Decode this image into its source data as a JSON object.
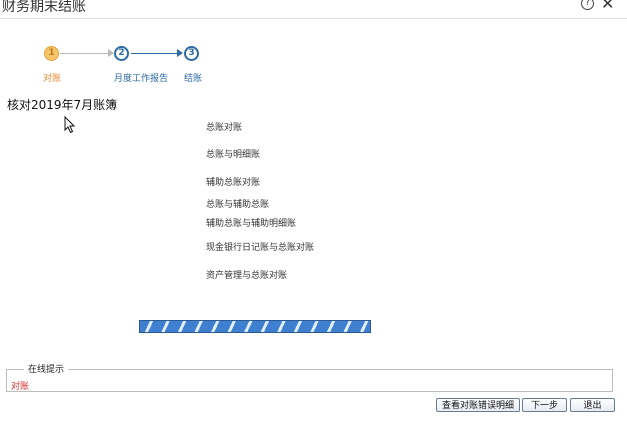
{
  "window": {
    "title": "财务期末结账",
    "help_icon_glyph": "?",
    "close_icon_glyph": "✕"
  },
  "steps": [
    {
      "number": "1",
      "label": "对账",
      "state": "current"
    },
    {
      "number": "2",
      "label": "月度工作报告",
      "state": "pending"
    },
    {
      "number": "3",
      "label": "结账",
      "state": "pending"
    }
  ],
  "main": {
    "heading": "核对2019年7月账簿",
    "check_items": [
      "总账对账",
      "总账与明细账",
      "辅助总账对账",
      "总账与辅助总账",
      "辅助总账与辅助明细账",
      "现金银行日记账与总账对账",
      "资产管理与总账对账"
    ],
    "progress_state": "running"
  },
  "online_tip": {
    "legend": "在线提示",
    "message": "对账"
  },
  "buttons": {
    "view_errors": "查看对账错误明细",
    "next": "下一步",
    "exit": "退出"
  },
  "colors": {
    "step_current": "#f5c56a",
    "step_pending": "#2b6aa3",
    "tip_text": "#d42a2a",
    "progress": "#3f7fcf"
  }
}
